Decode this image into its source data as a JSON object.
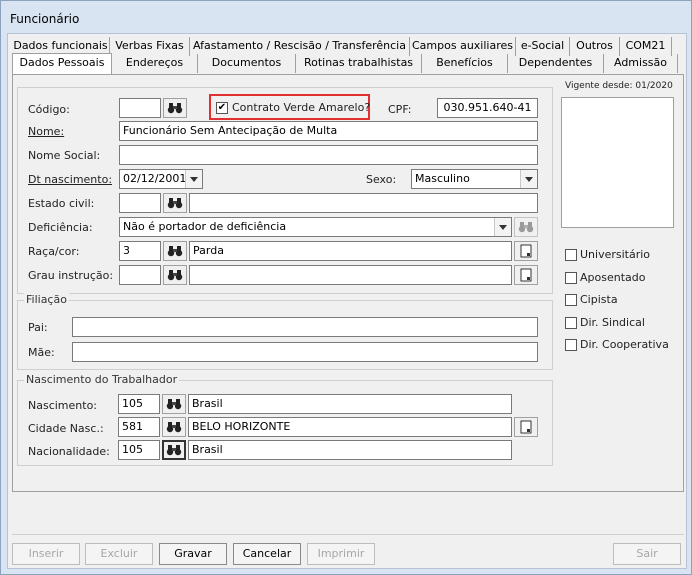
{
  "window": {
    "title": "Funcionário"
  },
  "tabs_row1": [
    "Dados funcionais",
    "Verbas Fixas",
    "Afastamento / Rescisão / Transferência",
    "Campos auxiliares",
    "e-Social",
    "Outros",
    "COM21"
  ],
  "tabs_row2": [
    "Dados Pessoais",
    "Endereços",
    "Documentos",
    "Rotinas trabalhistas",
    "Benefícios",
    "Dependentes",
    "Admissão"
  ],
  "active_tab": "Dados Pessoais",
  "form": {
    "codigo_label": "Código:",
    "codigo_value": "",
    "contrato_label": "Contrato Verde Amarelo?",
    "contrato_checked": true,
    "cpf_label": "CPF:",
    "cpf_value": "030.951.640-41",
    "nome_label": "Nome:",
    "nome_value": "Funcionário Sem Antecipação de Multa",
    "nome_social_label": "Nome Social:",
    "nome_social_value": "",
    "dt_nasc_label": "Dt nascimento:",
    "dt_nasc_value": "02/12/2001",
    "sexo_label": "Sexo:",
    "sexo_value": "Masculino",
    "estado_civil_label": "Estado civil:",
    "estado_civil_code": "",
    "estado_civil_desc": "",
    "deficiencia_label": "Deficiência:",
    "deficiencia_value": "Não é portador de deficiência",
    "raca_label": "Raça/cor:",
    "raca_code": "3",
    "raca_desc": "Parda",
    "grau_label": "Grau instrução:",
    "grau_code": "",
    "grau_desc": ""
  },
  "sidebar": {
    "vigente": "Vigente desde: 01/2020",
    "checkboxes": [
      {
        "label": "Universitário",
        "checked": false
      },
      {
        "label": "Aposentado",
        "checked": false
      },
      {
        "label": "Cipista",
        "checked": false
      },
      {
        "label": "Dir. Sindical",
        "checked": false
      },
      {
        "label": "Dir. Cooperativa",
        "checked": false
      }
    ]
  },
  "filiacao": {
    "legend": "Filiação",
    "pai_label": "Pai:",
    "pai_value": "",
    "mae_label": "Mãe:",
    "mae_value": ""
  },
  "nascimento": {
    "legend": "Nascimento do Trabalhador",
    "nasc_label": "Nascimento:",
    "nasc_code": "105",
    "nasc_desc": "Brasil",
    "cidade_label": "Cidade Nasc.:",
    "cidade_code": "581",
    "cidade_desc": "BELO HORIZONTE",
    "nac_label": "Nacionalidade:",
    "nac_code": "105",
    "nac_desc": "Brasil"
  },
  "buttons": {
    "inserir": "Inserir",
    "excluir": "Excluir",
    "gravar": "Gravar",
    "cancelar": "Cancelar",
    "imprimir": "Imprimir",
    "sair": "Sair"
  },
  "colors": {
    "highlight": "#e22f2f",
    "window_bg": "#d8e4f1",
    "panel_bg": "#f0f0f0"
  }
}
